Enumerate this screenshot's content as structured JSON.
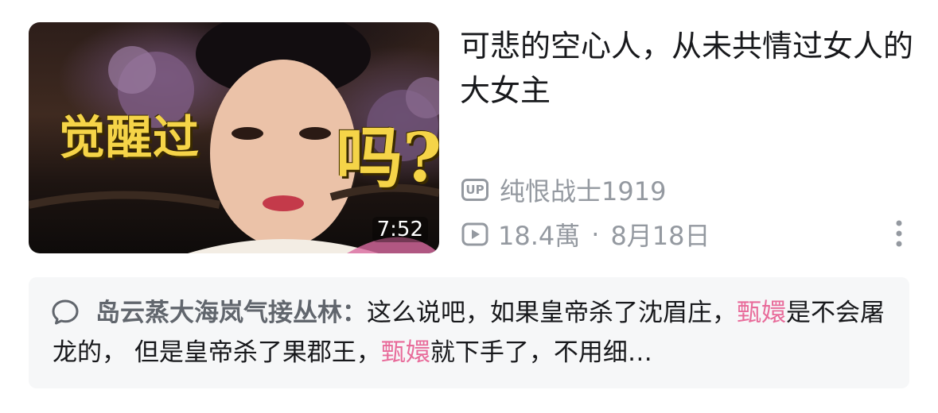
{
  "video": {
    "thumbnail_text_left": "觉醒过",
    "thumbnail_text_right": "吗?",
    "duration": "7:52",
    "title": "可悲的空心人，从未共情过女人的大女主",
    "up_label": "UP",
    "author": "纯恨战士1919",
    "views": "18.4萬",
    "separator": "·",
    "date": "8月18日"
  },
  "comment": {
    "user": "岛云蒸大海岚气接丛林：",
    "part1": "这么说吧，如果皇帝杀了沈眉庄，",
    "highlight1": "甄嬛",
    "part2": "是不会屠龙的， 但是皇帝杀了果郡王，",
    "highlight2": "甄嬛",
    "part3": "就下手了，不用细…"
  },
  "icons": {
    "up": "up-badge-icon",
    "views": "play-icon",
    "more": "more-vertical-icon",
    "comment": "speech-bubble-icon"
  },
  "colors": {
    "text": "#18191c",
    "meta": "#9499a0",
    "highlight": "#e86b9a",
    "overlay_text": "#f5d448",
    "comment_bg": "#f6f7f8"
  }
}
